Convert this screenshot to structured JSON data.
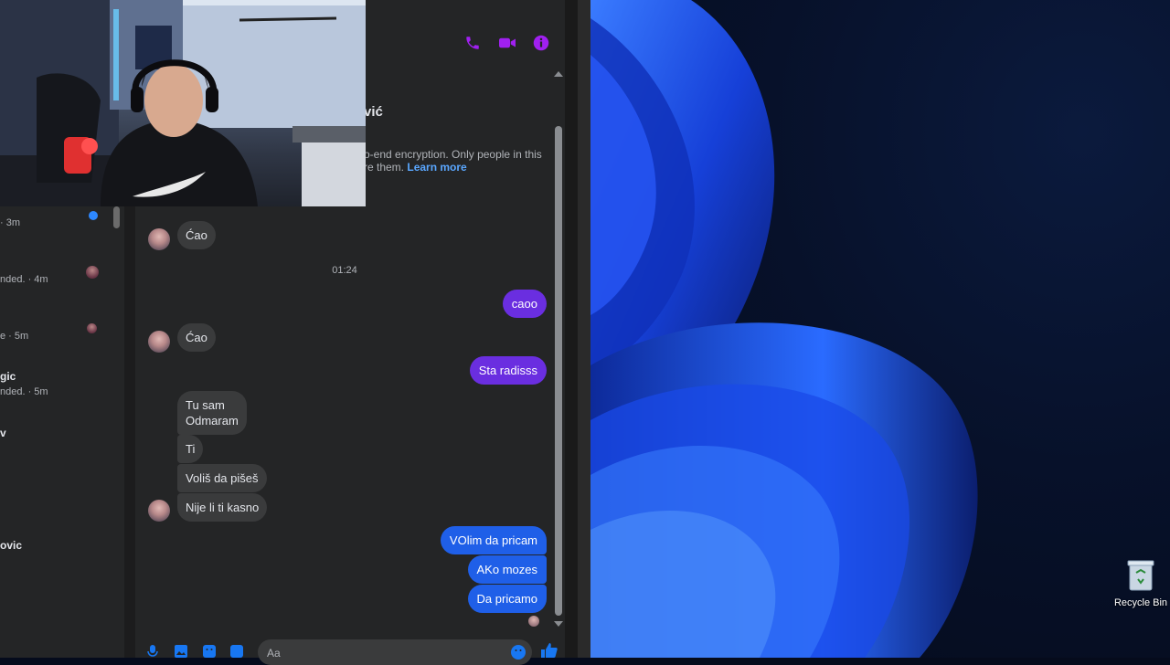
{
  "chat": {
    "contact_name_fragment": "vić",
    "encryption_text": "o-end encryption. Only people in this",
    "encryption_text_2": "re them.",
    "learn_more": "Learn more",
    "messages": [
      {
        "dir": "in",
        "text": "Ćao"
      },
      {
        "dir": "sep",
        "text": "01:24"
      },
      {
        "dir": "out",
        "text": "caoo"
      },
      {
        "dir": "in",
        "text": "Ćao"
      },
      {
        "dir": "out",
        "text": "Sta radisss"
      },
      {
        "dir": "in",
        "text_line1": "Tu sam",
        "text_line2": "Odmaram"
      },
      {
        "dir": "in",
        "text": "Ti"
      },
      {
        "dir": "in",
        "text": "Voliš da pišeš"
      },
      {
        "dir": "in",
        "text": "Nije li ti kasno"
      },
      {
        "dir": "out",
        "text": "VOlim da pricam"
      },
      {
        "dir": "out",
        "text": "AKo mozes"
      },
      {
        "dir": "out",
        "text": "Da pricamo"
      }
    ],
    "composer_placeholder": "Aa"
  },
  "sidebar": {
    "items": [
      {
        "name": "",
        "sub": "· 3m"
      },
      {
        "name": "",
        "sub": "nded. · 4m"
      },
      {
        "name": "",
        "sub": "e · 5m"
      },
      {
        "name": "gic",
        "sub": "nded. · 5m"
      },
      {
        "name": "v",
        "sub": ""
      },
      {
        "name": "ovic",
        "sub": ""
      }
    ]
  },
  "desktop": {
    "recycle_bin_label": "Recycle Bin"
  },
  "colors": {
    "accent": "#a020f0",
    "out_purple": "#6a2ee0",
    "out_blue": "#1f5fe8",
    "messenger_blue": "#1877f2"
  },
  "icons": [
    "phone-icon",
    "video-icon",
    "info-icon",
    "mic-icon",
    "image-icon",
    "sticker-icon",
    "gif-icon",
    "emoji-icon",
    "like-icon",
    "recycle-bin-icon"
  ]
}
